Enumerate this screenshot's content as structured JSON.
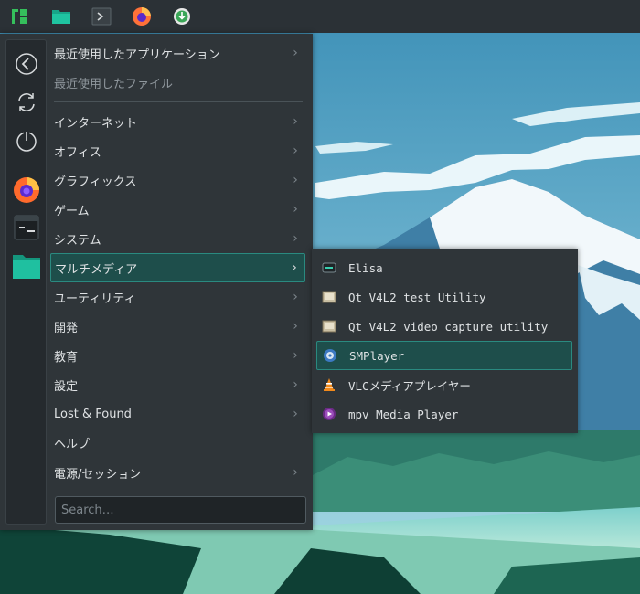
{
  "taskbar": {
    "icons": [
      "manjaro-logo-icon",
      "file-manager-icon",
      "terminal-icon",
      "firefox-icon",
      "downloader-icon"
    ]
  },
  "side_rail": {
    "icons": [
      "back-icon",
      "refresh-icon",
      "power-icon",
      "firefox-icon",
      "terminal-icon",
      "folder-icon"
    ]
  },
  "menu": {
    "items": [
      {
        "label": "最近使用したアプリケーション",
        "submenu": true
      },
      {
        "label": "最近使用したファイル",
        "submenu": false
      },
      {
        "label": "インターネット",
        "submenu": true
      },
      {
        "label": "オフィス",
        "submenu": true
      },
      {
        "label": "グラフィックス",
        "submenu": true
      },
      {
        "label": "ゲーム",
        "submenu": true
      },
      {
        "label": "システム",
        "submenu": true
      },
      {
        "label": "マルチメディア",
        "submenu": true,
        "active": true
      },
      {
        "label": "ユーティリティ",
        "submenu": true
      },
      {
        "label": "開発",
        "submenu": true
      },
      {
        "label": "教育",
        "submenu": true
      },
      {
        "label": "設定",
        "submenu": true
      },
      {
        "label": "Lost & Found",
        "submenu": true
      },
      {
        "label": "ヘルプ",
        "submenu": false
      },
      {
        "label": "電源/セッション",
        "submenu": true
      }
    ],
    "search_placeholder": "Search…"
  },
  "submenu": {
    "items": [
      {
        "label": "Elisa",
        "icon": "elisa-icon"
      },
      {
        "label": "Qt V4L2 test Utility",
        "icon": "qv4l2-icon"
      },
      {
        "label": "Qt V4L2 video capture utility",
        "icon": "qvidcap-icon"
      },
      {
        "label": "SMPlayer",
        "icon": "smplayer-icon",
        "active": true
      },
      {
        "label": "VLCメディアプレイヤー",
        "icon": "vlc-icon"
      },
      {
        "label": "mpv Media Player",
        "icon": "mpv-icon"
      }
    ]
  },
  "colors": {
    "panel": "#2b3136",
    "menu_bg": "#2f3539",
    "accent": "#2a8a80",
    "highlight": "#1e4e4b"
  }
}
